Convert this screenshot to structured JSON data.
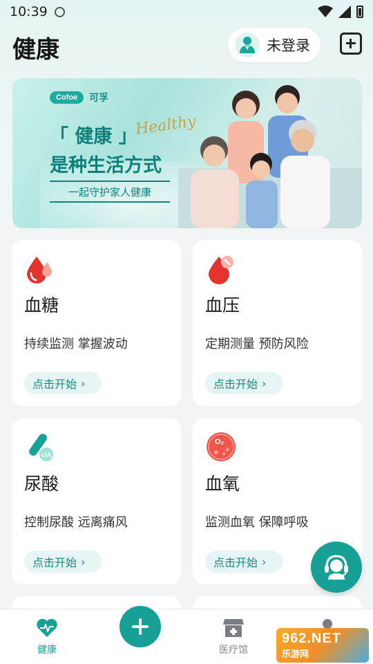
{
  "status_bar": {
    "time": "10:39"
  },
  "header": {
    "title": "健康",
    "login_label": "未登录"
  },
  "banner": {
    "brand_logo": "Cofoe",
    "brand_name": "可孚",
    "headline_line1": "「 健康 」",
    "script_word": "Healthy",
    "headline_line2": "是种生活方式",
    "tagline": "一起守护家人健康"
  },
  "cards": [
    {
      "title": "血糖",
      "desc": "持续监测 掌握波动",
      "button": "点击开始",
      "icon": "blood-drop-icon"
    },
    {
      "title": "血压",
      "desc": "定期测量 预防风险",
      "button": "点击开始",
      "icon": "blood-pressure-icon"
    },
    {
      "title": "尿酸",
      "desc": "控制尿酸 远离痛风",
      "button": "点击开始",
      "icon": "test-tube-icon"
    },
    {
      "title": "血氧",
      "desc": "监测血氧 保障呼吸",
      "button": "点击开始",
      "icon": "oxygen-icon"
    }
  ],
  "bottom_nav": {
    "home_label": "健康",
    "clinic_label": "医疗馆"
  },
  "watermark": {
    "top": "962.NET",
    "bottom": "乐游网"
  },
  "colors": {
    "accent": "#17a196",
    "red": "#e2332f",
    "card_btn_bg": "#e6f5f3"
  }
}
